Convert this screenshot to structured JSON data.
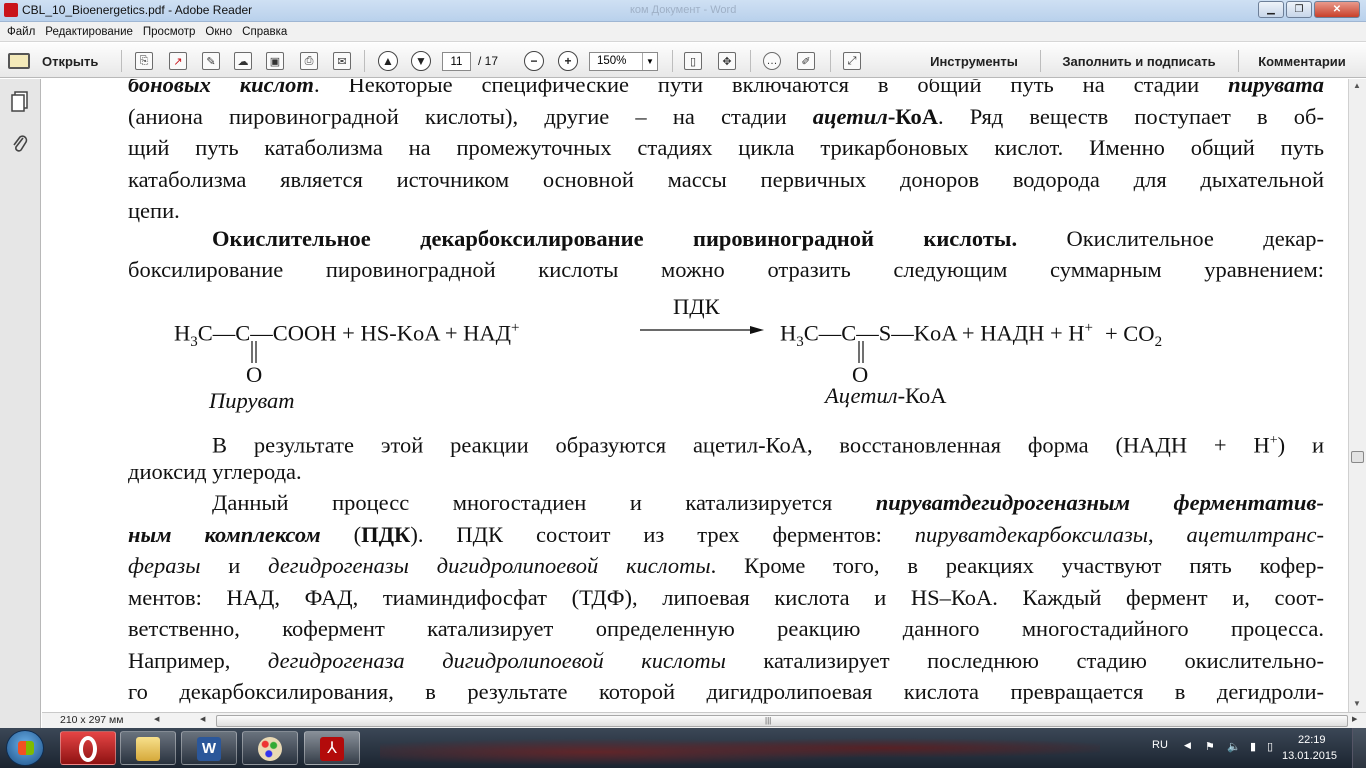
{
  "window": {
    "title": "CBL_10_Bioenergetics.pdf - Adobe Reader",
    "ghost_title": "ком Документ - Word",
    "min_icon": "minimize-icon",
    "max_icon": "maximize-icon",
    "close_icon": "close-icon"
  },
  "menu": [
    "Файл",
    "Редактирование",
    "Просмотр",
    "Окно",
    "Справка"
  ],
  "toolbar": {
    "open_label": "Открыть",
    "page_value": "11",
    "page_total": "/ 17",
    "zoom_value": "150%",
    "tools_label": "Инструменты",
    "fill_sign_label": "Заполнить и подписать",
    "comments_label": "Комментарии"
  },
  "document": {
    "lines": [
      {
        "parts": [
          {
            "t": "боновых кислот",
            "s": "bi"
          },
          {
            "t": ". Некоторые специфические пути включаются в общий путь на стадии ",
            "s": ""
          },
          {
            "t": "пирувата",
            "s": "bi"
          }
        ]
      },
      {
        "parts": [
          {
            "t": "(аниона пировиноградной кислоты), другие – на стадии ",
            "s": ""
          },
          {
            "t": "ацетил",
            "s": "bi"
          },
          {
            "t": "-КоА",
            "s": "b"
          },
          {
            "t": ". Ряд веществ поступает в об-",
            "s": ""
          }
        ]
      },
      {
        "parts": [
          {
            "t": "щий путь катаболизма на промежуточных стадиях цикла трикарбоновых кислот. Именно общий путь",
            "s": ""
          }
        ]
      },
      {
        "parts": [
          {
            "t": "катаболизма является источником основной массы первичных доноров водорода для дыхательной",
            "s": ""
          }
        ]
      },
      {
        "parts": [
          {
            "t": "цепи.",
            "s": ""
          }
        ]
      }
    ],
    "heading_bold": "Окислительное декарбоксилирование пировиноградной кислоты.",
    "heading_rest": " Окислительное декар-",
    "heading_line2": "боксилирование пировиноградной кислоты можно отразить следующим суммарным уравнением:",
    "equation": {
      "left_pre": "H",
      "left_sub": "3",
      "left_chain": "C—C—COOH  +  HS-KoA  +  НАД",
      "plus_sup": "+",
      "enzyme": "ПДК",
      "right_pre": "H",
      "right_sub": "3",
      "right_chain": "C—C—S—KoA  +  НАДН  +  H",
      "h_sup": "+",
      "co2": "+  CO",
      "co2_sub": "2",
      "oxygen": "O",
      "label_left": "Пируват",
      "label_right_italic": "Ацетил",
      "label_right_rest": "-КоА"
    },
    "para2_line1_a": "В результате этой реакции образуются ацетил-КоА, восстановленная форма (НАДН + H",
    "para2_line1_sup": "+",
    "para2_line1_b": ") и",
    "para2_line2": "диоксид углерода.",
    "para3": [
      {
        "parts": [
          {
            "t": "Данный процесс многостадиен и катализируется ",
            "s": ""
          },
          {
            "t": "пируватдегидрогеназным ферментатив-",
            "s": "bi"
          }
        ]
      },
      {
        "parts": [
          {
            "t": "ным комплексом",
            "s": "bi"
          },
          {
            "t": " (",
            "s": ""
          },
          {
            "t": "ПДК",
            "s": "b"
          },
          {
            "t": "). ПДК состоит из трех ферментов: ",
            "s": ""
          },
          {
            "t": "пируватдекарбоксилазы",
            "s": "i"
          },
          {
            "t": ", ",
            "s": ""
          },
          {
            "t": "ацетилтранс-",
            "s": "i"
          }
        ]
      },
      {
        "parts": [
          {
            "t": "феразы",
            "s": "i"
          },
          {
            "t": " и ",
            "s": ""
          },
          {
            "t": "дегидрогеназы дигидролипоевой кислоты",
            "s": "i"
          },
          {
            "t": ". Кроме того, в реакциях участвуют пять кофер-",
            "s": ""
          }
        ]
      },
      {
        "parts": [
          {
            "t": "ментов: НАД, ФАД, тиаминдифосфат (ТДФ), липоевая кислота и HS–КоА. Каждый фермент и, соот-",
            "s": ""
          }
        ]
      },
      {
        "parts": [
          {
            "t": "ветственно, кофермент катализирует определенную реакцию данного многостадийного процесса.",
            "s": ""
          }
        ]
      },
      {
        "parts": [
          {
            "t": "Например, ",
            "s": ""
          },
          {
            "t": "дегидрогеназа дигидролипоевой кислоты",
            "s": "i"
          },
          {
            "t": " катализирует последнюю стадию окислительно-",
            "s": ""
          }
        ]
      },
      {
        "parts": [
          {
            "t": "го декарбоксилирования, в результате которой дигидролипоевая кислота превращается в дегидроли-",
            "s": ""
          }
        ]
      }
    ]
  },
  "statusbar": {
    "page_size": "210 x 297 мм"
  },
  "taskbar": {
    "lang": "RU",
    "time": "22:19",
    "date": "13.01.2015"
  },
  "colors": {
    "reader_red": "#c9141b",
    "taskbar": "#1b2430"
  }
}
